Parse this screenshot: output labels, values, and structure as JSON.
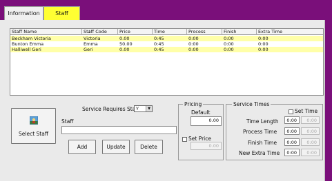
{
  "tabs": [
    {
      "label": "Information"
    },
    {
      "label": "Staff"
    }
  ],
  "grid": {
    "columns": [
      "Staff Name",
      "Staff Code",
      "Price",
      "Time",
      "Process",
      "Finish",
      "Extra Time"
    ],
    "rows": [
      [
        "Beckham Victoria",
        "Victoria",
        "0.00",
        "0:45",
        "0:00",
        "0:00",
        "0:00"
      ],
      [
        "Bunton Emma",
        "Emma",
        "50.00",
        "0:45",
        "0:00",
        "0:00",
        "0:00"
      ],
      [
        "Halliwell Geri",
        "Geri",
        "0.00",
        "0:45",
        "0:00",
        "0:00",
        "0:00"
      ]
    ]
  },
  "form": {
    "select_staff_label": "Select Staff",
    "service_requires_label": "Service Requires Staff",
    "service_requires_value": "Y",
    "staff_label": "Staff",
    "staff_value": "",
    "add_label": "Add",
    "update_label": "Update",
    "delete_label": "Delete"
  },
  "pricing": {
    "title": "Pricing",
    "default_label": "Default",
    "default_value": "0.00",
    "set_price_label": "Set Price",
    "set_price_value": "0.00"
  },
  "service_times": {
    "title": "Service Times",
    "set_time_label": "Set Time",
    "rows": [
      {
        "label": "Time Length",
        "value": "0:00",
        "set_value": "0:00"
      },
      {
        "label": "Process Time",
        "value": "0:00",
        "set_value": "0:00"
      },
      {
        "label": "Finish Time",
        "value": "0:00",
        "set_value": "0:00"
      },
      {
        "label": "New Extra Time",
        "value": "0:00",
        "set_value": "0:00"
      }
    ]
  },
  "colors": {
    "topbar": "#7a0f7a",
    "active_tab": "#ffff33",
    "row_highlight": "#ffffa8"
  },
  "icons": {
    "select_staff": "staff-picture-icon",
    "dropdown": "chevron-down-icon"
  }
}
